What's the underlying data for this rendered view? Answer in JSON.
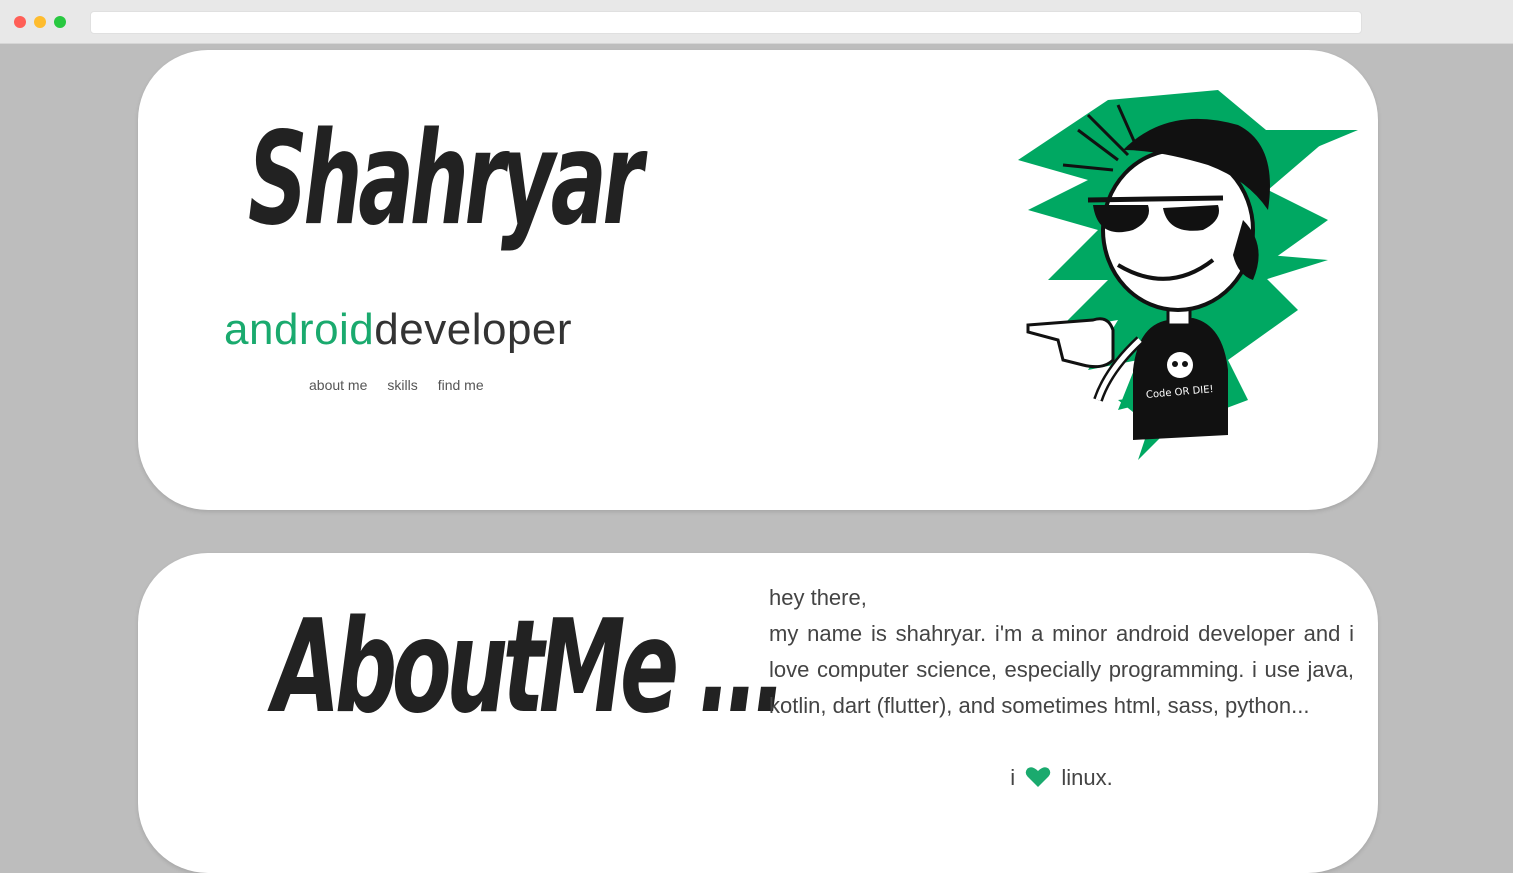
{
  "hero": {
    "name": "Shahryar",
    "subtitle_accent": "android",
    "subtitle_rest": "developer",
    "nav": [
      "about me",
      "skills",
      "find me"
    ],
    "illustration_shirt_text": "Code OR DIE!"
  },
  "about": {
    "title": "AboutMe ...",
    "paragraphs": [
      "hey there,",
      "my name is shahryar. i'm a minor android developer and i love computer science, especially programming. i use java, kotlin, dart (flutter), and sometimes html, sass, python..."
    ],
    "love_prefix": "i",
    "love_suffix": "linux."
  },
  "colors": {
    "accent": "#1aaa6e",
    "background": "#bdbdbd",
    "card": "#ffffff",
    "text": "#222222"
  },
  "icons": {
    "love": "heart-icon"
  }
}
